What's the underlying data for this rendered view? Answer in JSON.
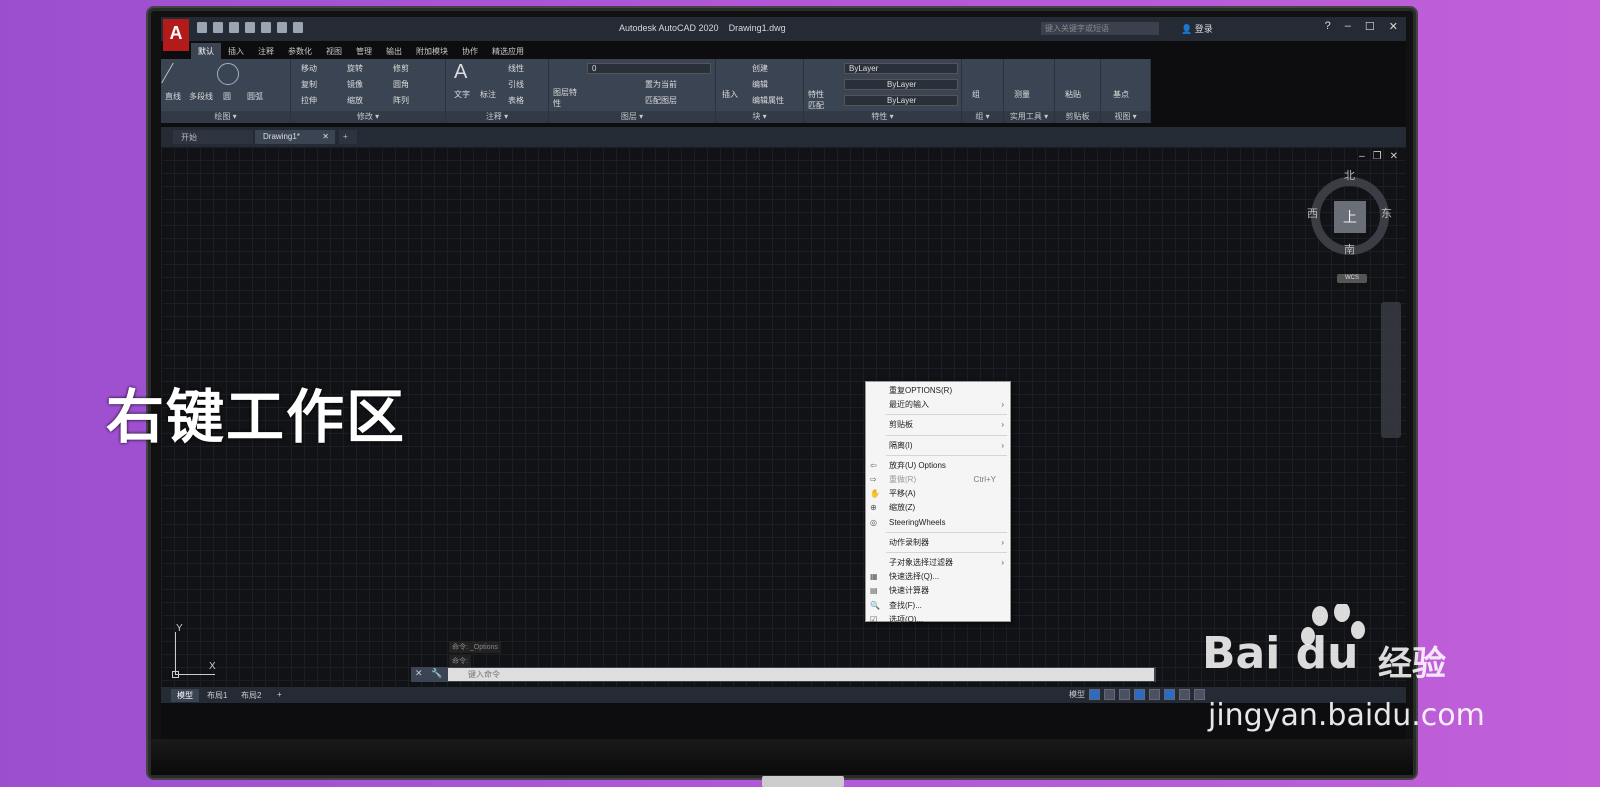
{
  "title_bar": {
    "app_title": "Autodesk AutoCAD 2020",
    "file_name": "Drawing1.dwg",
    "logo": "A",
    "search_placeholder": "键入关键字或短语",
    "login_label": "登录",
    "help_icon": "?"
  },
  "ribbon_tabs": [
    "默认",
    "插入",
    "注释",
    "参数化",
    "视图",
    "管理",
    "输出",
    "附加模块",
    "协作",
    "精选应用"
  ],
  "ribbon": {
    "draw": {
      "title": "绘图 ▾",
      "tools": [
        "直线",
        "多段线",
        "圆",
        "圆弧"
      ]
    },
    "modify": {
      "title": "修改 ▾",
      "tools": [
        "移动",
        "旋转",
        "修剪",
        "复制",
        "镜像",
        "圆角",
        "拉伸",
        "缩放",
        "阵列"
      ]
    },
    "annotation": {
      "title": "注释 ▾",
      "tools": [
        "文字",
        "标注",
        "线性",
        "引线",
        "表格"
      ]
    },
    "layers": {
      "title": "图层 ▾",
      "tools": [
        "图层特性",
        "置为当前",
        "匹配图层"
      ],
      "current_layer": "0"
    },
    "block": {
      "title": "块 ▾",
      "tools": [
        "插入",
        "创建",
        "编辑",
        "编辑属性"
      ]
    },
    "properties": {
      "title": "特性 ▾",
      "tools": [
        "特性匹配"
      ],
      "color": "ByLayer",
      "linetype": "ByLayer",
      "lineweight": "ByLayer"
    },
    "groups": {
      "title": "组 ▾",
      "tools": [
        "组"
      ]
    },
    "utilities": {
      "title": "实用工具 ▾",
      "tools": [
        "测量"
      ]
    },
    "clipboard": {
      "title": "剪贴板",
      "tools": [
        "粘贴"
      ]
    },
    "view": {
      "title": "视图 ▾",
      "tools": [
        "基点"
      ]
    }
  },
  "doc_tabs": [
    "开始",
    "Drawing1*"
  ],
  "viewcube": {
    "north": "北",
    "south": "南",
    "east": "东",
    "west": "西",
    "face": "上",
    "wcs": "WCS"
  },
  "overlay_caption": "右键工作区",
  "context_menu": {
    "items": [
      {
        "label": "重复OPTIONS(R)",
        "submenu": false,
        "disabled": false
      },
      {
        "label": "最近的输入",
        "submenu": true,
        "disabled": false
      },
      {
        "label": "剪贴板",
        "submenu": true,
        "disabled": false
      },
      {
        "label": "隔离(I)",
        "submenu": true,
        "disabled": false
      },
      {
        "label": "放弃(U) Options",
        "submenu": false,
        "disabled": false
      },
      {
        "label": "重做(R)",
        "shortcut": "Ctrl+Y",
        "submenu": false,
        "disabled": true
      },
      {
        "label": "平移(A)",
        "submenu": false,
        "disabled": false
      },
      {
        "label": "缩放(Z)",
        "submenu": false,
        "disabled": false
      },
      {
        "label": "SteeringWheels",
        "submenu": false,
        "disabled": false
      },
      {
        "label": "动作录制器",
        "submenu": true,
        "disabled": false
      },
      {
        "label": "子对象选择过滤器",
        "submenu": true,
        "disabled": false
      },
      {
        "label": "快速选择(Q)...",
        "submenu": false,
        "disabled": false
      },
      {
        "label": "快速计算器",
        "submenu": false,
        "disabled": false
      },
      {
        "label": "查找(F)...",
        "submenu": false,
        "disabled": false
      },
      {
        "label": "选项(O)...",
        "submenu": false,
        "disabled": false
      }
    ]
  },
  "ucs": {
    "x": "X",
    "y": "Y"
  },
  "command": {
    "history_1": "命令: _Options",
    "history_2": "命令:",
    "placeholder": "键入命令"
  },
  "layout_tabs": [
    "模型",
    "布局1",
    "布局2"
  ],
  "status": {
    "model_label": "模型"
  },
  "watermark": {
    "brand": "Bai du",
    "product": "经验",
    "url": "jingyan.baidu.com"
  },
  "colors": {
    "accent": "#2b6cc2",
    "logo_red": "#b31b1b",
    "ribbon_bg": "#3b4453"
  }
}
